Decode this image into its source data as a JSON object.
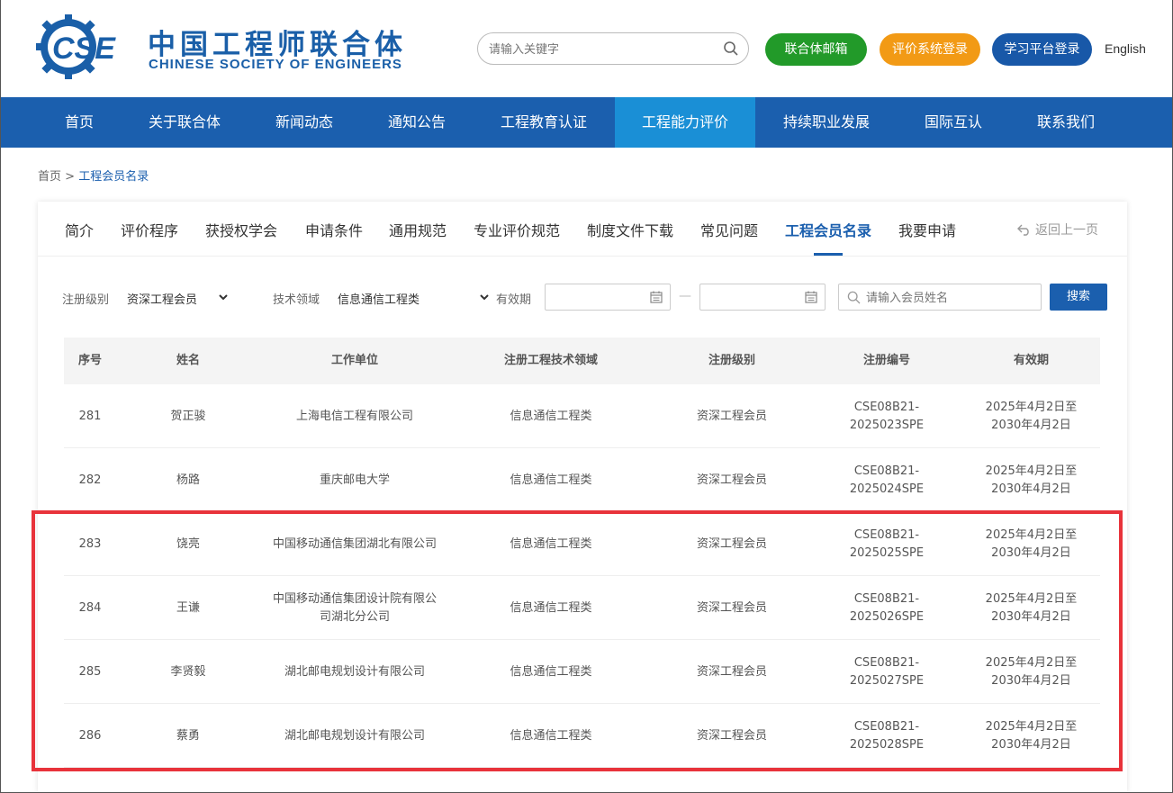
{
  "header": {
    "logo_cn": "中国工程师联合体",
    "logo_en": "CHINESE SOCIETY OF ENGINEERS",
    "logo_mark_text": "CSE",
    "search_placeholder": "请输入关键字",
    "btn_mail": "联合体邮箱",
    "btn_eval": "评价系统登录",
    "btn_learn": "学习平台登录",
    "lang": "English",
    "colors": {
      "brand": "#1b5fae",
      "mail": "#229a29",
      "eval": "#f29a15",
      "learn": "#1858a8"
    }
  },
  "nav": {
    "items": [
      "首页",
      "关于联合体",
      "新闻动态",
      "通知公告",
      "工程教育认证",
      "工程能力评价",
      "持续职业发展",
      "国际互认",
      "联系我们"
    ],
    "active_index": 5
  },
  "breadcrumb": {
    "home": "首页",
    "sep": ">",
    "current": "工程会员名录"
  },
  "tabs": {
    "items": [
      "简介",
      "评价程序",
      "获授权学会",
      "申请条件",
      "通用规范",
      "专业评价规范",
      "制度文件下载",
      "常见问题",
      "工程会员名录",
      "我要申请"
    ],
    "active_index": 8,
    "back": "返回上一页"
  },
  "filters": {
    "level_label": "注册级别",
    "level_value": "资深工程会员",
    "field_label": "技术领域",
    "field_value": "信息通信工程类",
    "validity_label": "有效期",
    "date_sep": "—",
    "name_placeholder": "请输入会员姓名",
    "search_button": "搜索"
  },
  "table": {
    "headers": [
      "序号",
      "姓名",
      "工作单位",
      "注册工程技术领域",
      "注册级别",
      "注册编号",
      "有效期"
    ],
    "rows": [
      {
        "no": "281",
        "name": "贺正骏",
        "org": "上海电信工程有限公司",
        "field": "信息通信工程类",
        "level": "资深工程会员",
        "code1": "CSE08B21-",
        "code2": "2025023SPE",
        "valid1": "2025年4月2日至",
        "valid2": "2030年4月2日"
      },
      {
        "no": "282",
        "name": "杨路",
        "org": "重庆邮电大学",
        "field": "信息通信工程类",
        "level": "资深工程会员",
        "code1": "CSE08B21-",
        "code2": "2025024SPE",
        "valid1": "2025年4月2日至",
        "valid2": "2030年4月2日"
      },
      {
        "no": "283",
        "name": "饶亮",
        "org": "中国移动通信集团湖北有限公司",
        "field": "信息通信工程类",
        "level": "资深工程会员",
        "code1": "CSE08B21-",
        "code2": "2025025SPE",
        "valid1": "2025年4月2日至",
        "valid2": "2030年4月2日"
      },
      {
        "no": "284",
        "name": "王谦",
        "org": "中国移动通信集团设计院有限公司湖北分公司",
        "field": "信息通信工程类",
        "level": "资深工程会员",
        "code1": "CSE08B21-",
        "code2": "2025026SPE",
        "valid1": "2025年4月2日至",
        "valid2": "2030年4月2日"
      },
      {
        "no": "285",
        "name": "李贤毅",
        "org": "湖北邮电规划设计有限公司",
        "field": "信息通信工程类",
        "level": "资深工程会员",
        "code1": "CSE08B21-",
        "code2": "2025027SPE",
        "valid1": "2025年4月2日至",
        "valid2": "2030年4月2日"
      },
      {
        "no": "286",
        "name": "蔡勇",
        "org": "湖北邮电规划设计有限公司",
        "field": "信息通信工程类",
        "level": "资深工程会员",
        "code1": "CSE08B21-",
        "code2": "2025028SPE",
        "valid1": "2025年4月2日至",
        "valid2": "2030年4月2日"
      }
    ],
    "highlight_color": "#e8333b"
  }
}
